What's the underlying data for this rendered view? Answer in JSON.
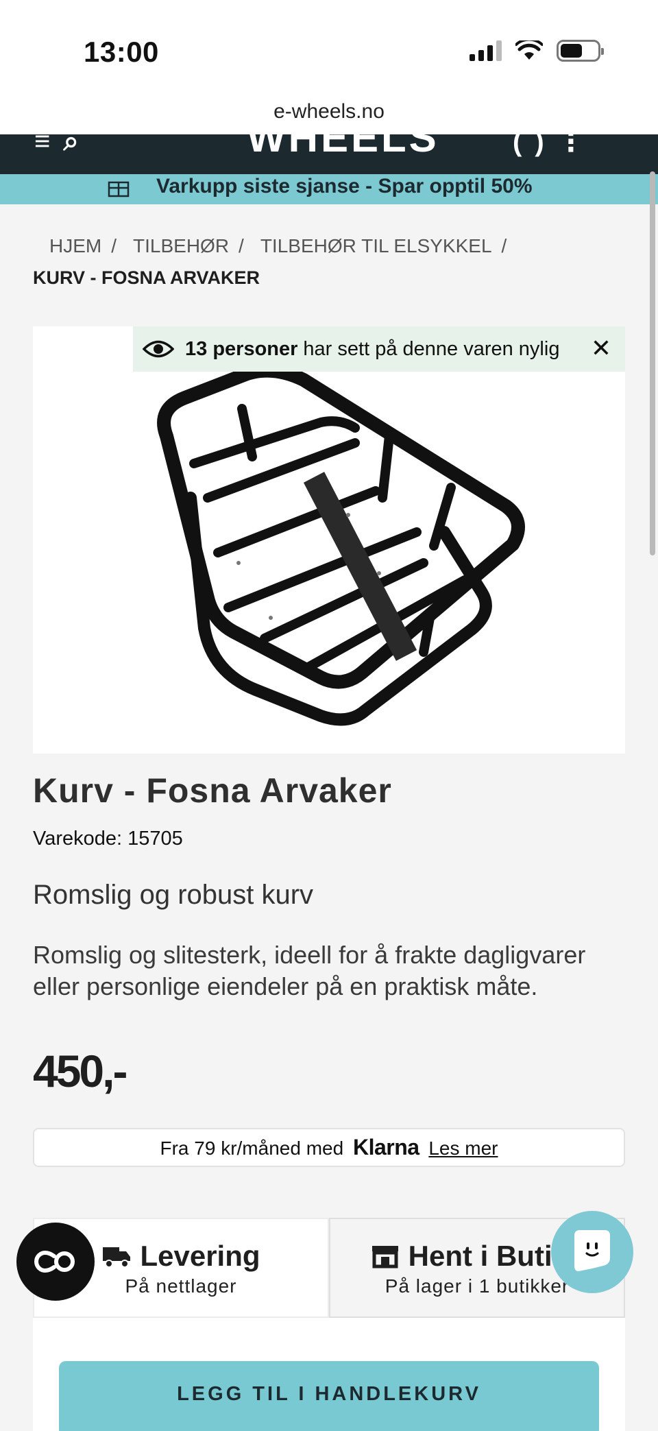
{
  "status_bar": {
    "time": "13:00"
  },
  "browser": {
    "url": "e-wheels.no"
  },
  "header": {
    "ghost_logo": "WHEELS",
    "ghost_left": "≡ ⌕",
    "ghost_right": "( )  ⋮"
  },
  "promo": {
    "text": "Varkupp siste sjanse - Spar opptil 50%"
  },
  "breadcrumb": {
    "items": [
      "HJEM",
      "TILBEHØR",
      "TILBEHØR TIL ELSYKKEL"
    ],
    "separator": "/",
    "current": "KURV - FOSNA ARVAKER"
  },
  "viewers": {
    "count": "13 personer",
    "text": "har sett på denne varen nylig",
    "close": "✕"
  },
  "product": {
    "title": "Kurv - Fosna Arvaker",
    "sku": "Varekode: 15705",
    "subtitle": "Romslig og robust kurv",
    "description": "Romslig og slitesterk, ideell for å frakte dagligvarer eller personlige eiendeler på en praktisk måte.",
    "price": "450,-"
  },
  "klarna": {
    "prefix": "Fra 79 kr/måned med",
    "brand": "Klarna",
    "link": "Les mer"
  },
  "tabs": [
    {
      "title": "Levering",
      "sub": "På nettlager",
      "icon": "truck-icon"
    },
    {
      "title": "Hent i Butikk",
      "sub": "På lager i 1 butikker",
      "icon": "store-icon"
    }
  ],
  "cart": {
    "button_label": "LEGG TIL I HANDLEKURV"
  },
  "colors": {
    "accent": "#79c9d3",
    "header_bg": "#1c2a30",
    "viewers_bg": "#e7f2ea"
  }
}
